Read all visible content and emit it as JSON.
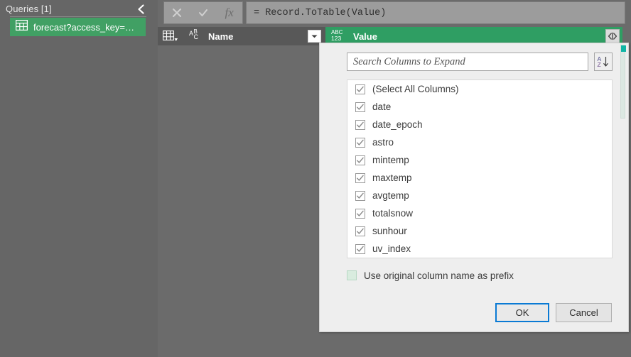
{
  "sidebar": {
    "title": "Queries [1]",
    "collapse_icon": "chevron-left-icon",
    "query": {
      "icon": "table-icon",
      "label": "forecast?access_key=…"
    }
  },
  "formula_bar": {
    "cancel_icon": "close-x-icon",
    "accept_icon": "checkmark-icon",
    "fx_label": "fx",
    "formula": "= Record.ToTable(Value)"
  },
  "table": {
    "selector_icon": "select-table-icon",
    "columns": [
      {
        "name": "Name",
        "type_icon": "abc-text-type-icon",
        "dropdown_icon": "chevron-down-icon",
        "highlighted": false
      },
      {
        "name": "Value",
        "type_icon": "abc123-any-type-icon",
        "expand_icon": "expand-columns-icon",
        "highlighted": true
      }
    ]
  },
  "dialog": {
    "search": {
      "placeholder": "Search Columns to Expand",
      "value": "",
      "sort_icon": "sort-az-icon"
    },
    "list": [
      {
        "label": "(Select All Columns)",
        "checked": true
      },
      {
        "label": "date",
        "checked": true
      },
      {
        "label": "date_epoch",
        "checked": true
      },
      {
        "label": "astro",
        "checked": true
      },
      {
        "label": "mintemp",
        "checked": true
      },
      {
        "label": "maxtemp",
        "checked": true
      },
      {
        "label": "avgtemp",
        "checked": true
      },
      {
        "label": "totalsnow",
        "checked": true
      },
      {
        "label": "sunhour",
        "checked": true
      },
      {
        "label": "uv_index",
        "checked": true
      }
    ],
    "prefix_option": {
      "label": "Use original column name as prefix",
      "checked": false
    },
    "ok_label": "OK",
    "cancel_label": "Cancel"
  },
  "colors": {
    "accent_green": "#2f9e63",
    "query_selected_green": "#41a064",
    "focus_blue": "#0a7ad4",
    "shell_gray": "#6b6b6b",
    "header_gray": "#585858",
    "dialog_bg": "#eeeeee"
  }
}
